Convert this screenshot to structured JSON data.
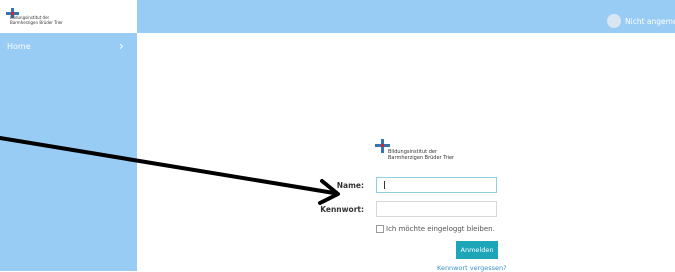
{
  "sidebar": {
    "logo_text_line1": "Bildungsinstitut der",
    "logo_text_line2": "Barmherzigen Brüder Trier",
    "items": [
      {
        "label": "Home",
        "icon": "chevron-right-icon"
      }
    ]
  },
  "topbar": {
    "status_text": "Nicht angemelde"
  },
  "login": {
    "logo_text_line1": "Bildungsinstitut der",
    "logo_text_line2": "Barmherzigen Brüder Trier",
    "name_label": "Name:",
    "password_label": "Kennwort:",
    "name_value": "",
    "password_value": "",
    "remember_label": "Ich möchte eingeloggt bleiben.",
    "remember_checked": false,
    "submit_label": "Anmelden",
    "forgot_label": "Kennwort vergessen?"
  },
  "colors": {
    "sidebar": "#99ccf5",
    "button": "#1da6b8",
    "link": "#3a8fcc",
    "logo_cross_blue": "#2f76b8",
    "logo_cross_red": "#d8232a"
  }
}
